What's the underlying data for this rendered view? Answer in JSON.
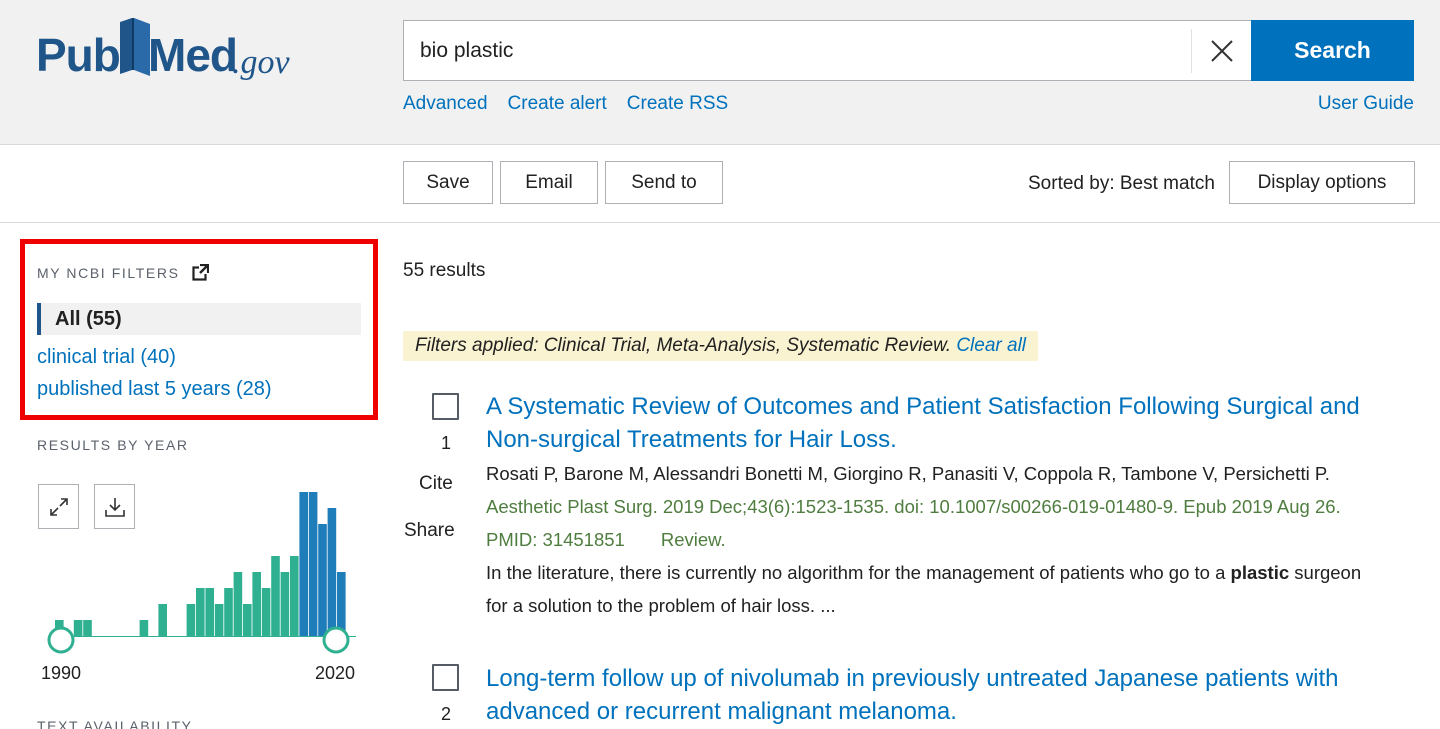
{
  "header": {
    "logo": {
      "brand": "PubMed",
      "suffix": ".gov"
    },
    "search": {
      "value": "bio plastic",
      "button_label": "Search"
    },
    "links": [
      "Advanced",
      "Create alert",
      "Create RSS"
    ],
    "user_guide": "User Guide"
  },
  "toolbar": {
    "save": "Save",
    "email": "Email",
    "send_to": "Send to",
    "sorted_by": "Sorted by: Best match",
    "display_options": "Display options"
  },
  "sidebar": {
    "my_filters_title": "MY NCBI FILTERS",
    "filters": [
      {
        "label": "All (55)",
        "active": true
      },
      {
        "label": "clinical trial (40)",
        "active": false
      },
      {
        "label": "published last 5 years (28)",
        "active": false
      }
    ],
    "results_by_year_title": "RESULTS BY YEAR",
    "year_start": "1990",
    "year_end": "2020",
    "text_availability_title": "TEXT AVAILABILITY"
  },
  "chart_data": {
    "type": "bar",
    "x": [
      1990,
      1991,
      1992,
      1993,
      1994,
      1995,
      1996,
      1997,
      1998,
      1999,
      2000,
      2001,
      2002,
      2003,
      2004,
      2005,
      2006,
      2007,
      2008,
      2009,
      2010,
      2011,
      2012,
      2013,
      2014,
      2015,
      2016,
      2017,
      2018,
      2019,
      2020
    ],
    "values": [
      1,
      0,
      1,
      1,
      0,
      0,
      0,
      0,
      0,
      1,
      0,
      2,
      0,
      0,
      2,
      3,
      3,
      2,
      3,
      4,
      2,
      4,
      3,
      5,
      4,
      5,
      9,
      9,
      7,
      8,
      4
    ],
    "highlight_range": [
      2016,
      2020
    ],
    "colors": {
      "normal": "#2fb091",
      "highlight": "#1f7dba"
    }
  },
  "main": {
    "results_count": "55 results",
    "filters_applied_prefix": "Filters applied: Clinical Trial, Meta-Analysis, Systematic Review. ",
    "clear_all": "Clear all",
    "cite_label": "Cite",
    "share_label": "Share",
    "results": [
      {
        "num": "1",
        "title": "A Systematic Review of Outcomes and Patient Satisfaction Following Surgical and Non-surgical Treatments for Hair Loss.",
        "authors": "Rosati P, Barone M, Alessandri Bonetti M, Giorgino R, Panasiti V, Coppola R, Tambone V, Persichetti P.",
        "citation": "Aesthetic Plast Surg. 2019 Dec;43(6):1523-1535. doi: 10.1007/s00266-019-01480-9. Epub 2019 Aug 26.",
        "pmid": "PMID: 31451851",
        "type": "Review.",
        "snippet_before": "In the literature, there is currently no algorithm for the management of patients who go to a ",
        "snippet_bold": "plastic",
        "snippet_after": " surgeon for a solution to the problem of hair loss. ..."
      },
      {
        "num": "2",
        "title": "Long-term follow up of nivolumab in previously untreated Japanese patients with advanced or recurrent malignant melanoma."
      }
    ]
  }
}
